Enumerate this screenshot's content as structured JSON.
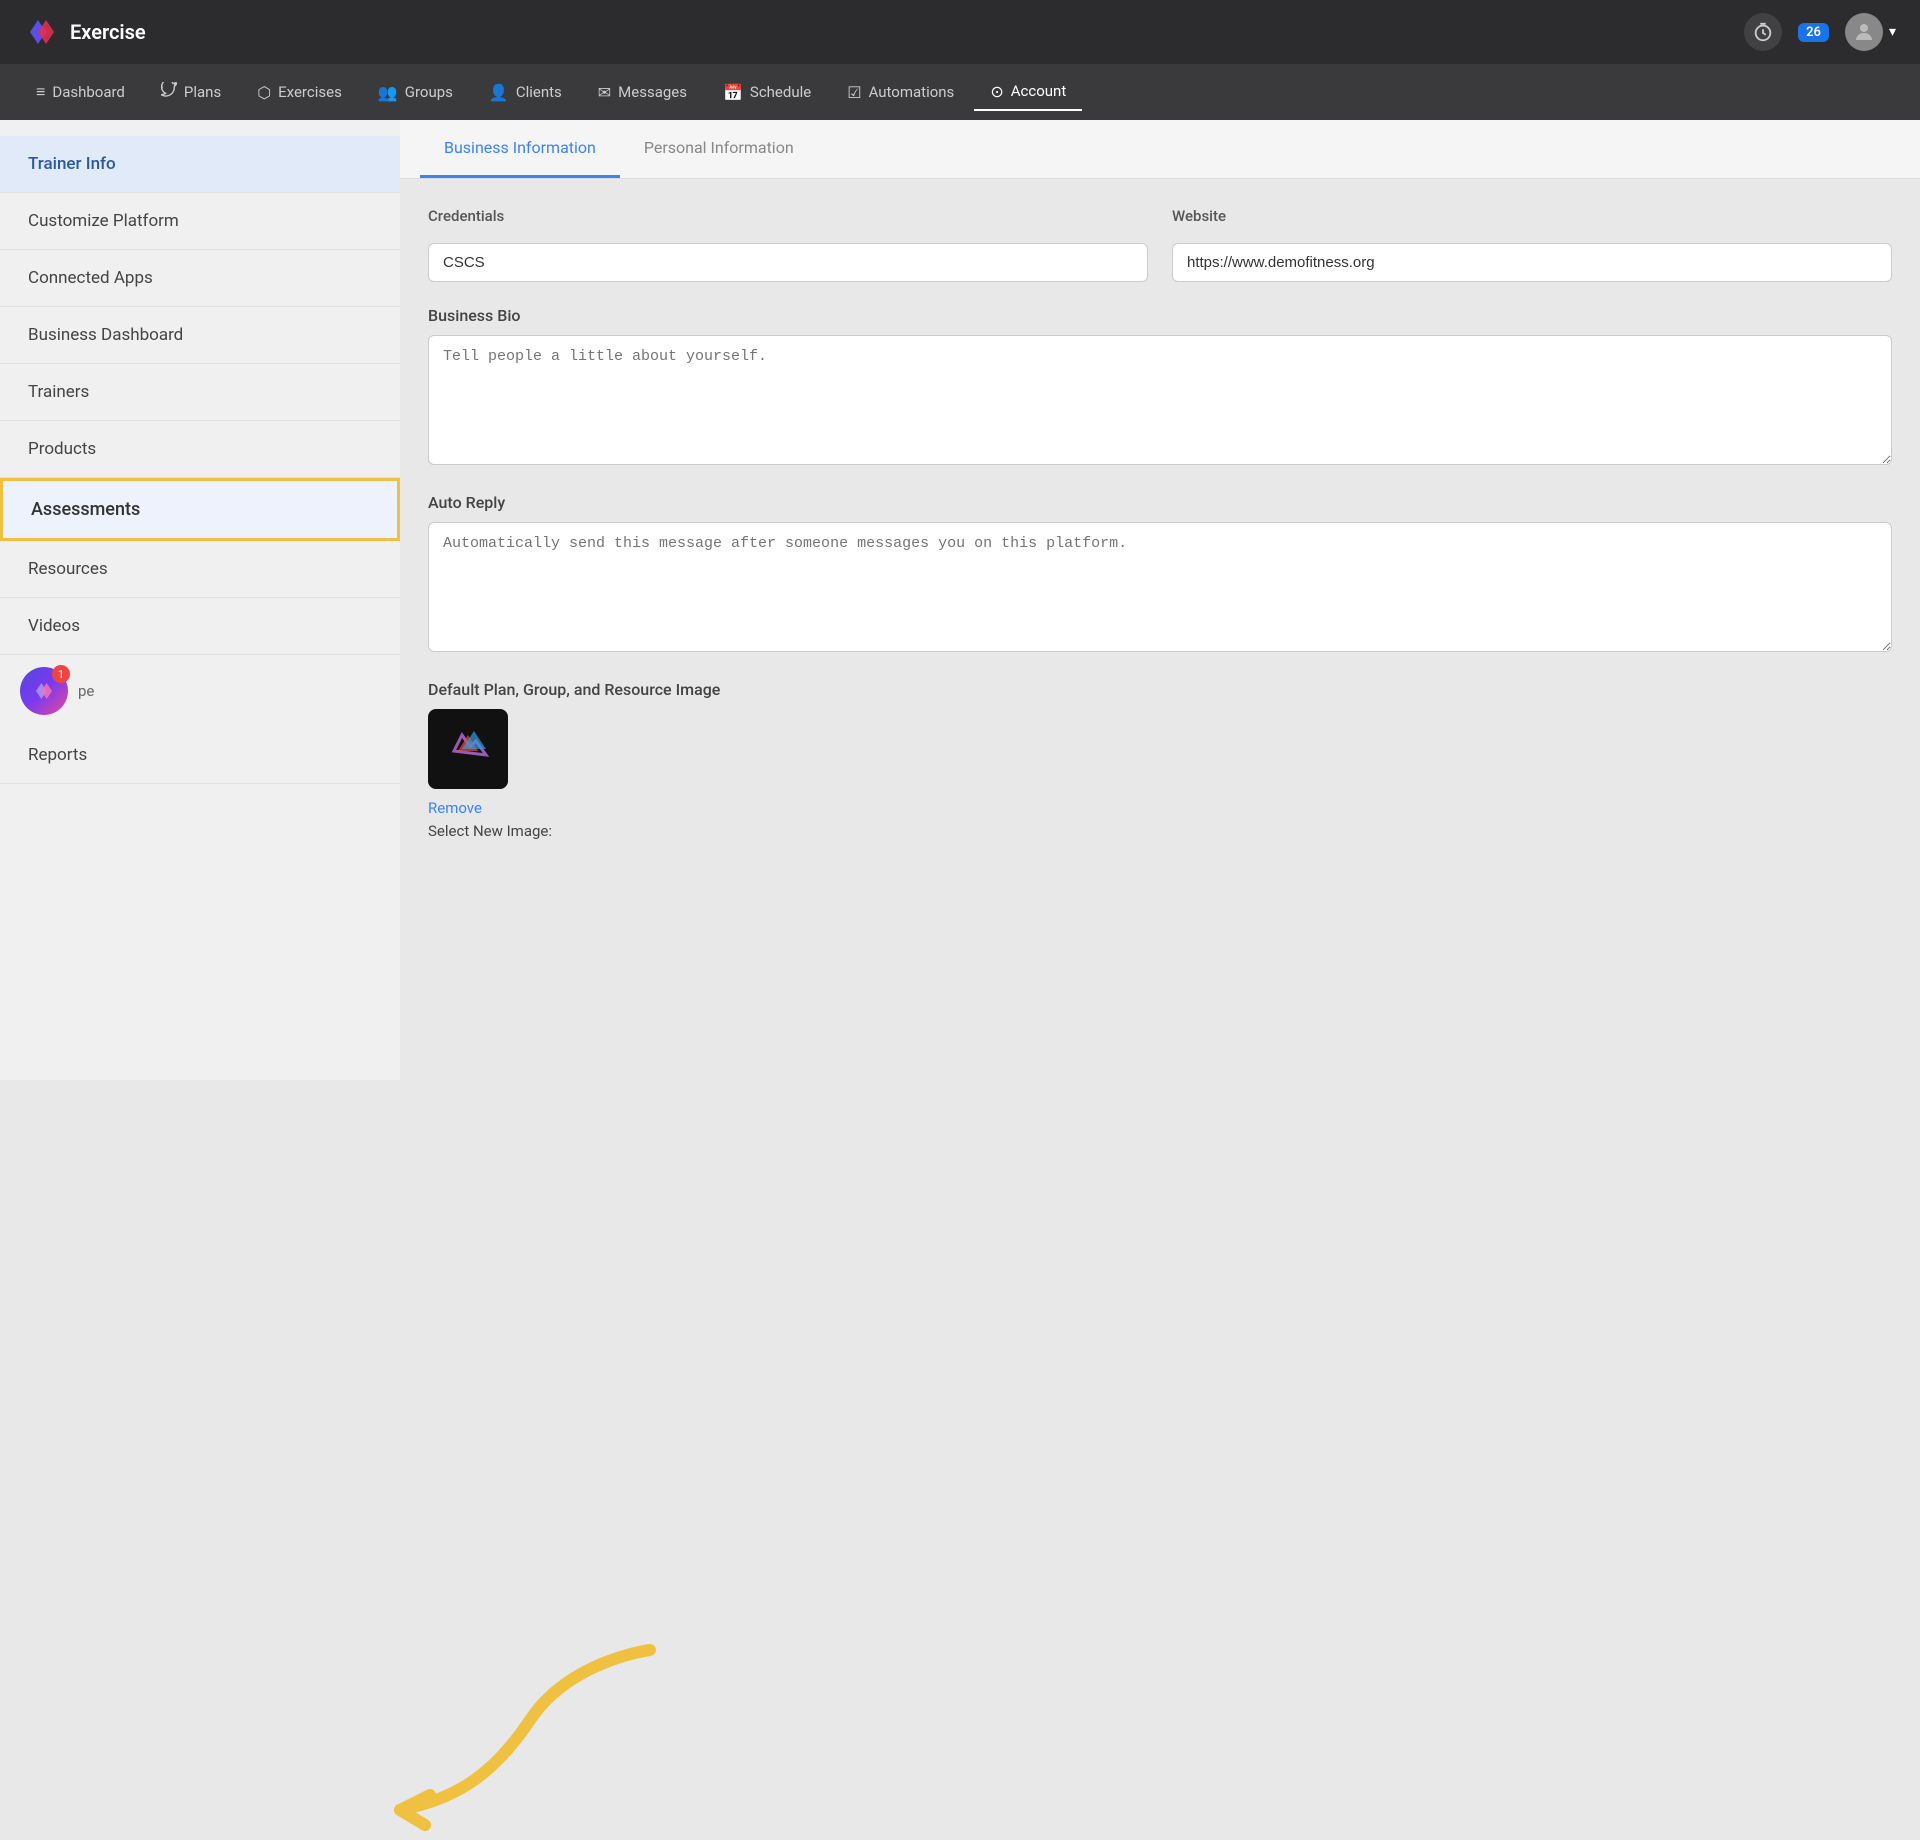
{
  "app": {
    "name": "Exercise",
    "logo_color": "#5b4de8"
  },
  "topbar": {
    "notification_count": "26",
    "timer_icon": "⏱",
    "chevron": "▾"
  },
  "nav": {
    "items": [
      {
        "id": "dashboard",
        "label": "Dashboard",
        "icon": "≡",
        "active": false
      },
      {
        "id": "plans",
        "label": "Plans",
        "icon": "🐦",
        "active": false
      },
      {
        "id": "exercises",
        "label": "Exercises",
        "icon": "⬡",
        "active": false
      },
      {
        "id": "groups",
        "label": "Groups",
        "icon": "👥",
        "active": false
      },
      {
        "id": "clients",
        "label": "Clients",
        "icon": "👤",
        "active": false
      },
      {
        "id": "messages",
        "label": "Messages",
        "icon": "✉",
        "active": false
      },
      {
        "id": "schedule",
        "label": "Schedule",
        "icon": "📅",
        "active": false
      },
      {
        "id": "automations",
        "label": "Automations",
        "icon": "☑",
        "active": false
      },
      {
        "id": "account",
        "label": "Account",
        "icon": "⊙",
        "active": true
      }
    ]
  },
  "sidebar": {
    "items": [
      {
        "id": "trainer-info",
        "label": "Trainer Info",
        "active": true,
        "highlighted": false
      },
      {
        "id": "customize-platform",
        "label": "Customize Platform",
        "active": false,
        "highlighted": false
      },
      {
        "id": "connected-apps",
        "label": "Connected Apps",
        "active": false,
        "highlighted": false
      },
      {
        "id": "business-dashboard",
        "label": "Business Dashboard",
        "active": false,
        "highlighted": false
      },
      {
        "id": "trainers",
        "label": "Trainers",
        "active": false,
        "highlighted": false
      },
      {
        "id": "products",
        "label": "Products",
        "active": false,
        "highlighted": false
      },
      {
        "id": "assessments",
        "label": "Assessments",
        "active": false,
        "highlighted": true
      },
      {
        "id": "resources",
        "label": "Resources",
        "active": false,
        "highlighted": false
      },
      {
        "id": "videos",
        "label": "Videos",
        "active": false,
        "highlighted": false
      }
    ],
    "bottom_item": {
      "label": "pe",
      "notification": "1"
    },
    "reports_label": "Reports"
  },
  "tabs": [
    {
      "id": "business-info",
      "label": "Business Information",
      "active": true
    },
    {
      "id": "personal-info",
      "label": "Personal Information",
      "active": false
    }
  ],
  "form": {
    "credentials_label": "Credentials",
    "credentials_value": "CSCS",
    "website_label": "Website",
    "website_value": "https://www.demofitness.org",
    "bio_label": "Business Bio",
    "bio_placeholder": "Tell people a little about yourself.",
    "auto_reply_label": "Auto Reply",
    "auto_reply_placeholder": "Automatically send this message after someone messages you on this platform.",
    "default_image_label": "Default Plan, Group, and Resource Image",
    "remove_label": "Remove",
    "select_new_label": "Select New Image:"
  }
}
